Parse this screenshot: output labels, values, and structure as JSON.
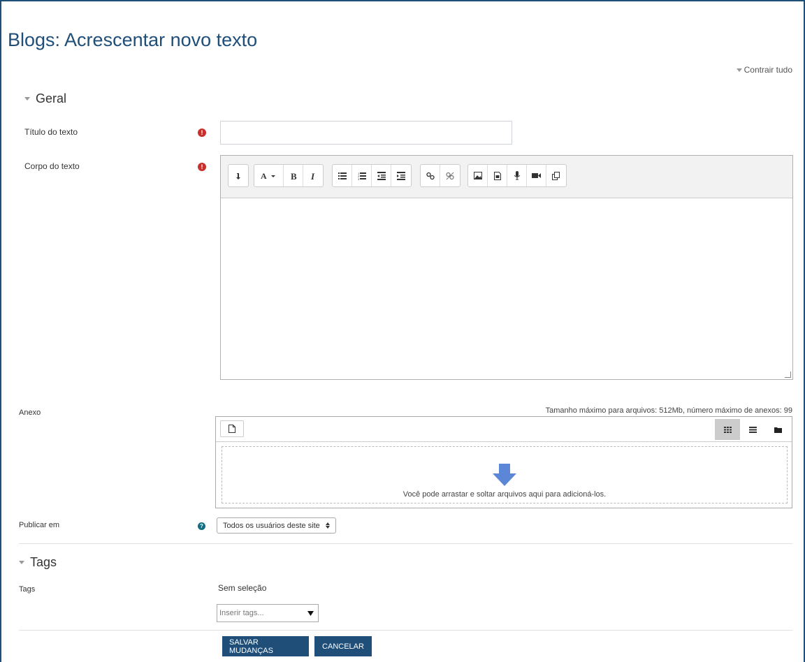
{
  "page": {
    "title": "Blogs: Acrescentar novo texto",
    "collapse_all": "Contrair tudo"
  },
  "sections": {
    "general": {
      "label": "Geral"
    },
    "tags": {
      "label": "Tags"
    }
  },
  "fields": {
    "title": {
      "label": "Título do texto",
      "value": "",
      "required_icon": "!"
    },
    "body": {
      "label": "Corpo do texto",
      "required_icon": "!"
    },
    "attachment": {
      "label": "Anexo",
      "info": "Tamanho máximo para arquivos: 512Mb, número máximo de anexos: 99",
      "drop_text": "Você pode arrastar e soltar arquivos aqui para adicioná-los."
    },
    "publish": {
      "label": "Publicar em",
      "selected": "Todos os usuários deste site",
      "help_icon": "?"
    },
    "tags": {
      "label": "Tags",
      "selection": "Sem seleção",
      "placeholder": "Inserir tags..."
    }
  },
  "editor_toolbar": {
    "groups": [
      [
        "collapse-icon"
      ],
      [
        "font-style-icon",
        "bold-icon",
        "italic-icon"
      ],
      [
        "unordered-list-icon",
        "ordered-list-icon",
        "outdent-icon",
        "indent-icon"
      ],
      [
        "link-icon",
        "unlink-icon"
      ],
      [
        "image-icon",
        "media-icon",
        "record-audio-icon",
        "record-video-icon",
        "manage-files-icon"
      ]
    ]
  },
  "buttons": {
    "save": "SALVAR MUDANÇAS",
    "cancel": "CANCELAR"
  },
  "colors": {
    "primary": "#1f4e79",
    "required": "#c9302c",
    "help": "#0f6e84"
  }
}
